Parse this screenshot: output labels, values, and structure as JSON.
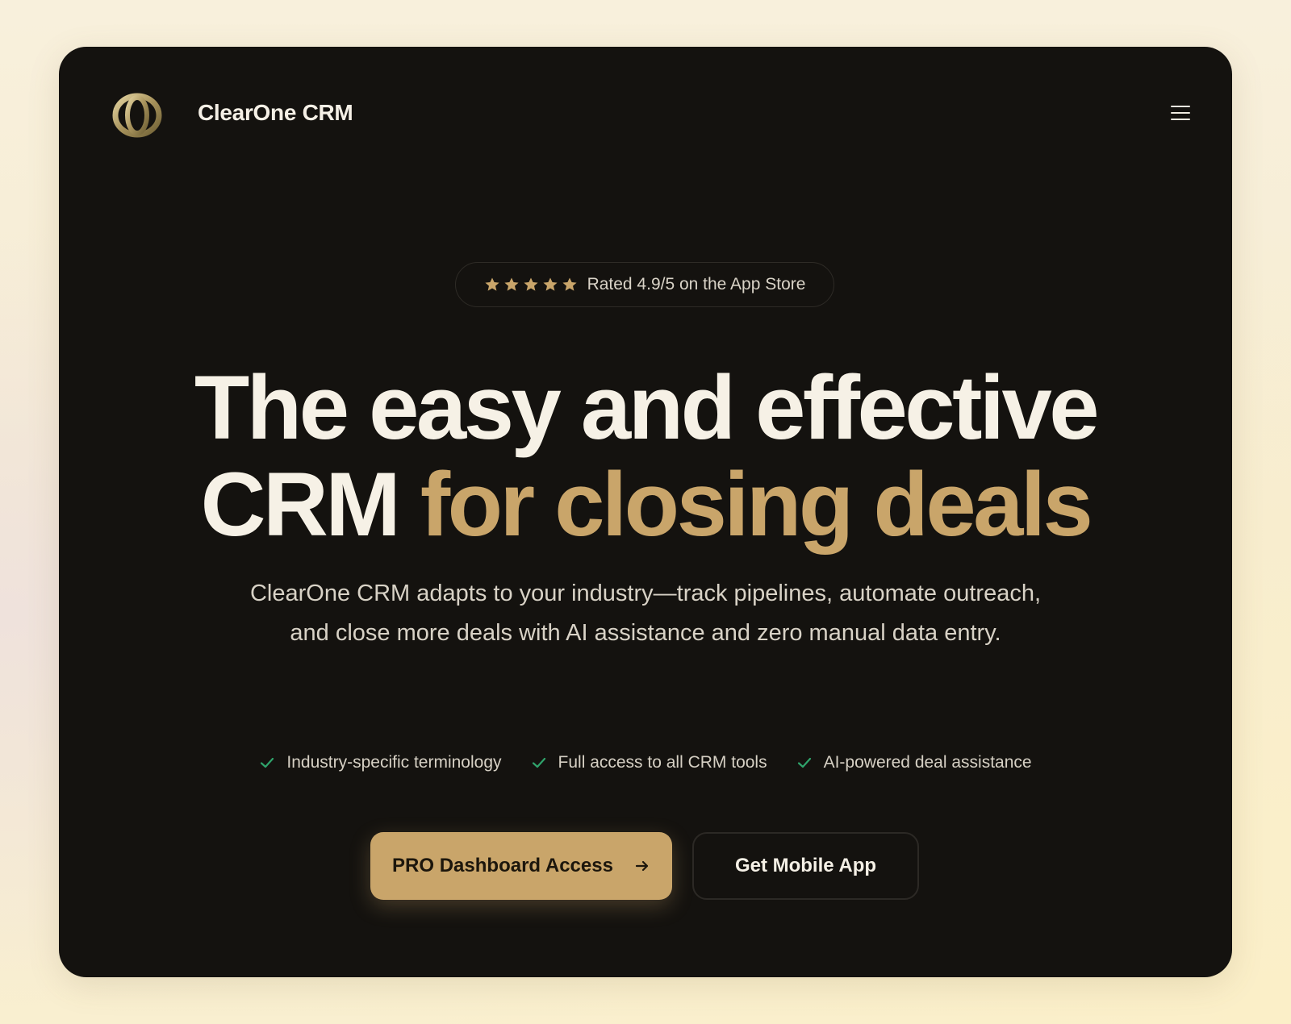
{
  "nav": {
    "brand": "ClearOne CRM",
    "logo_icon": "interlocking-rings-logo",
    "menu_icon": "hamburger-menu-icon"
  },
  "rating": {
    "stars": 5,
    "text": "Rated 4.9/5 on the App Store",
    "star_icon": "star-icon"
  },
  "hero": {
    "headline_line1": "The easy and effective",
    "headline_line2_plain": "CRM",
    "headline_line2_accent": "for closing deals",
    "subtitle": "ClearOne CRM adapts to your industry—track pipelines, automate outreach, and close more deals with AI assistance and zero manual data entry."
  },
  "features": [
    {
      "label": "Industry-specific terminology",
      "icon": "check-icon"
    },
    {
      "label": "Full access to all CRM tools",
      "icon": "check-icon"
    },
    {
      "label": "AI-powered deal assistance",
      "icon": "check-icon"
    }
  ],
  "cta": {
    "primary_label": "PRO Dashboard Access",
    "primary_icon": "arrow-right-icon",
    "secondary_label": "Get Mobile App"
  },
  "colors": {
    "card_background": "#14120f",
    "accent_gold": "#c9a56a",
    "check_green": "#2fa36b",
    "text_light": "#f6f1e6"
  }
}
